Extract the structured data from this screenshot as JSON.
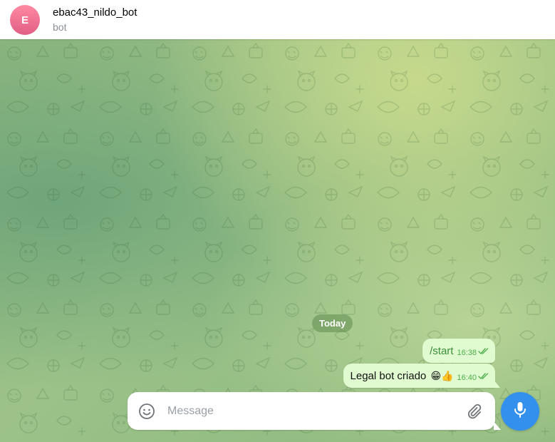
{
  "header": {
    "avatar_letter": "E",
    "title": "ebac43_nildo_bot",
    "status": "bot"
  },
  "chat": {
    "date_label": "Today",
    "messages": [
      {
        "text": "/start",
        "emoji": "",
        "time": "16:38",
        "status_icon": "double-check-icon"
      },
      {
        "text": "Legal bot criado",
        "emoji": "😁👍",
        "time": "16:40",
        "status_icon": "double-check-icon"
      }
    ]
  },
  "composer": {
    "placeholder": "Message",
    "emoji_icon": "smile-icon",
    "attach_icon": "paperclip-icon",
    "mic_icon": "microphone-icon"
  },
  "colors": {
    "accent": "#3390ec",
    "outgoing_bubble": "#e0fbcf",
    "check_color": "#4fae4e",
    "avatar": "#e8688c"
  }
}
